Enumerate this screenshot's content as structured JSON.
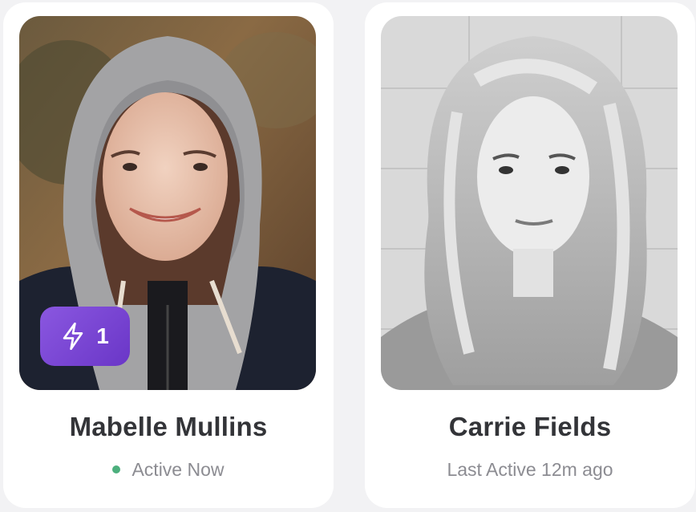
{
  "profiles": [
    {
      "name": "Mabelle Mullins",
      "status": "Active Now",
      "status_dot_color": "#4caf7d",
      "boost": {
        "icon": "lightning-icon",
        "count": "1",
        "color": "#7b48d6"
      }
    },
    {
      "name": "Carrie Fields",
      "status": "Last Active 12m ago"
    }
  ]
}
